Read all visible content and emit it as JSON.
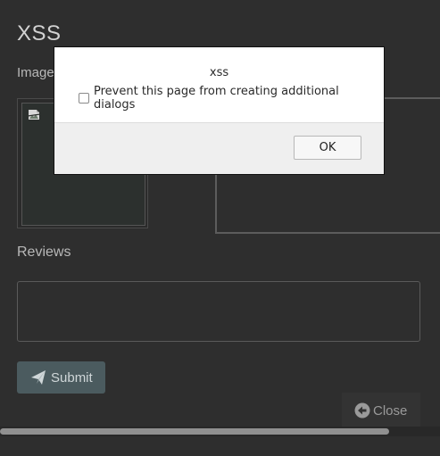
{
  "page": {
    "title": "XSS",
    "images_label": "Image",
    "reviews_label": "Reviews",
    "reviews_value": "",
    "submit_label": "Submit",
    "close_label": "Close"
  },
  "dialog": {
    "message": "xss",
    "checkbox_label": "Prevent this page from creating additional dialogs",
    "checkbox_checked": false,
    "ok_label": "OK"
  },
  "icons": {
    "submit": "paper-plane-icon",
    "close": "arrow-left-circle-icon",
    "image": "broken-image-icon"
  },
  "colors": {
    "background": "#2e2e2e",
    "submit_button": "#4b5b5f",
    "dialog_bg": "#ffffff",
    "dialog_footer": "#efefef"
  }
}
